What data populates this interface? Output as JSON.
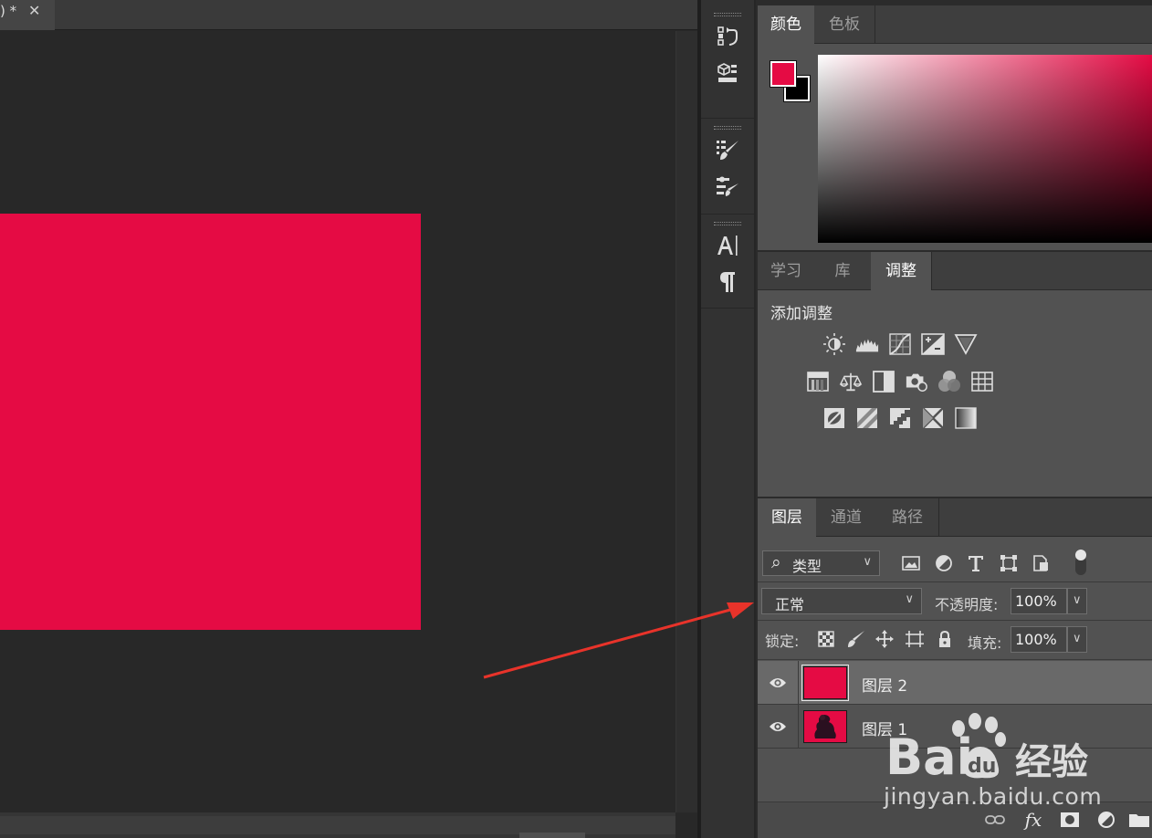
{
  "document": {
    "tab_title": ") *",
    "close_glyph": "✕"
  },
  "tool_strip": {
    "groups": [
      [
        "history-icon",
        "3d-icon"
      ],
      [
        "brush-presets-icon",
        "brush-settings-icon"
      ],
      [
        "character-icon",
        "paragraph-icon"
      ]
    ]
  },
  "color_panel": {
    "tabs": [
      "颜色",
      "色板"
    ],
    "active_tab": 0,
    "foreground_color": "#e50b44",
    "background_color": "#000000"
  },
  "adjust_panel": {
    "tabs": [
      "学习",
      "库",
      "调整"
    ],
    "active_tab": 2,
    "heading": "添加调整",
    "icon_rows": [
      [
        "brightness-contrast-icon",
        "levels-icon",
        "curves-icon",
        "exposure-icon",
        "vibrance-icon"
      ],
      [
        "hue-saturation-icon",
        "color-balance-icon",
        "black-white-icon",
        "photo-filter-icon",
        "channel-mixer-icon",
        "color-lookup-icon"
      ],
      [
        "invert-icon",
        "posterize-icon",
        "threshold-icon",
        "selective-color-icon",
        "gradient-map-icon"
      ]
    ]
  },
  "layers_panel": {
    "tabs": [
      "图层",
      "通道",
      "路径"
    ],
    "active_tab": 0,
    "filter": {
      "search_glyph": "⌕",
      "label": "类型"
    },
    "blend_mode": "正常",
    "opacity_label": "不透明度:",
    "opacity_value": "100%",
    "lock_label": "锁定:",
    "fill_label": "填充:",
    "fill_value": "100%",
    "layers": [
      {
        "name": "图层 2",
        "selected": true,
        "visible": true
      },
      {
        "name": "图层 1",
        "selected": false,
        "visible": true
      }
    ],
    "footer": {
      "fx_label": "fx"
    }
  },
  "watermark": {
    "url": "jingyan.baidu.com"
  },
  "colors": {
    "accent_red": "#e50b44",
    "arrow_red": "#e8332a"
  }
}
